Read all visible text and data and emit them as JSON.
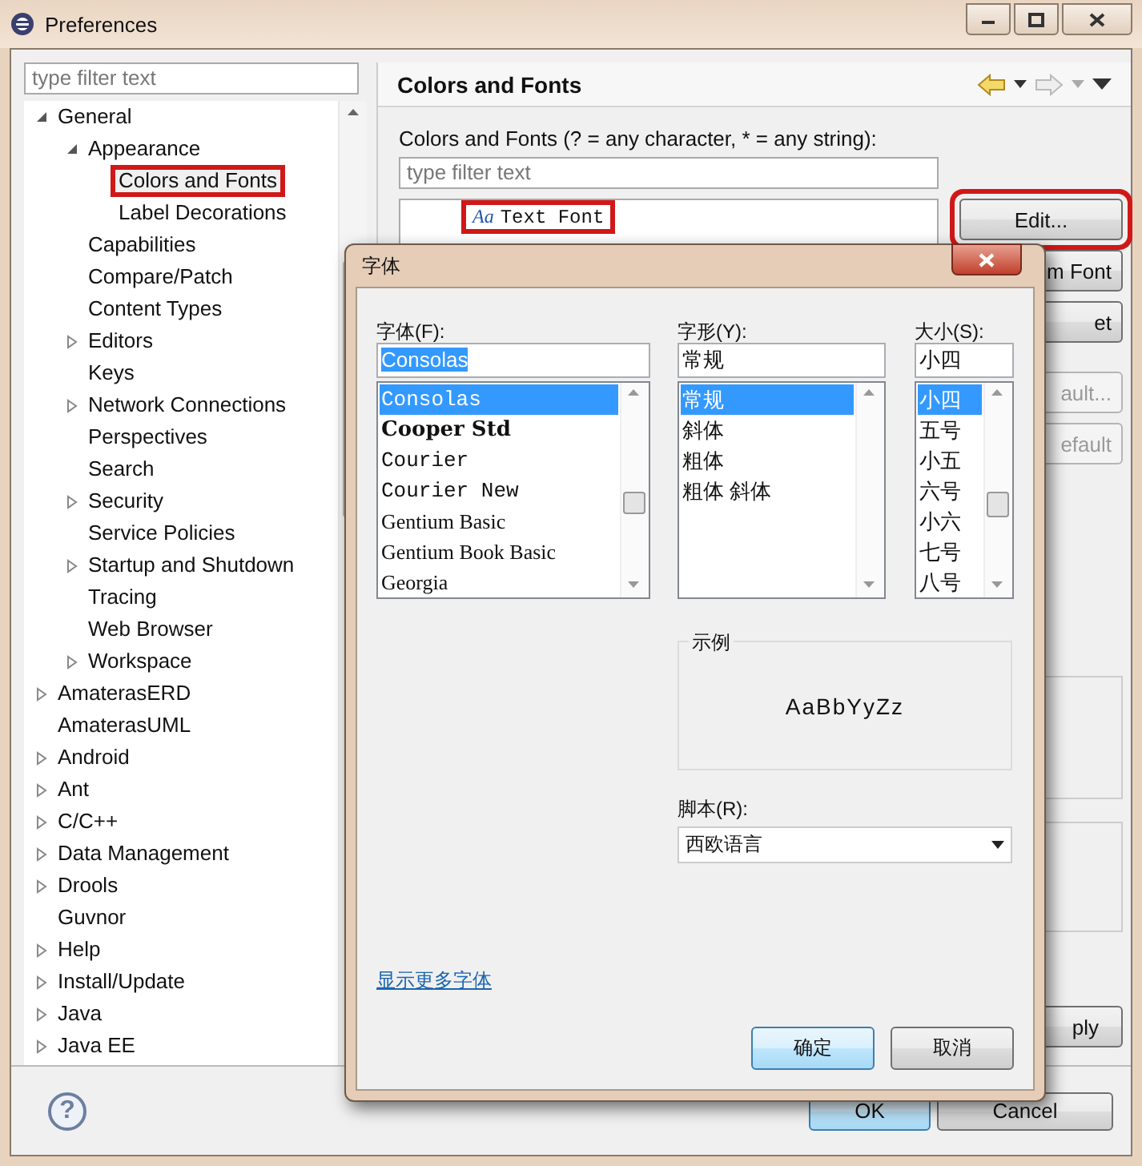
{
  "window": {
    "title": "Preferences"
  },
  "sidebar": {
    "filter_placeholder": "type filter text",
    "tree": [
      {
        "label": "General",
        "expandable": true,
        "expanded": true,
        "selected": false,
        "highlighted": false,
        "children": [
          {
            "label": "Appearance",
            "expandable": true,
            "expanded": true,
            "selected": false,
            "highlighted": false,
            "children": [
              {
                "label": "Colors and Fonts",
                "expandable": false,
                "selected": true,
                "highlighted": true
              },
              {
                "label": "Label Decorations",
                "expandable": false,
                "selected": false,
                "highlighted": false
              }
            ]
          },
          {
            "label": "Capabilities",
            "expandable": false,
            "selected": false,
            "highlighted": false
          },
          {
            "label": "Compare/Patch",
            "expandable": false,
            "selected": false,
            "highlighted": false
          },
          {
            "label": "Content Types",
            "expandable": false,
            "selected": false,
            "highlighted": false
          },
          {
            "label": "Editors",
            "expandable": true,
            "expanded": false,
            "selected": false,
            "highlighted": false
          },
          {
            "label": "Keys",
            "expandable": false,
            "selected": false,
            "highlighted": false
          },
          {
            "label": "Network Connections",
            "expandable": true,
            "expanded": false,
            "selected": false,
            "highlighted": false
          },
          {
            "label": "Perspectives",
            "expandable": false,
            "selected": false,
            "highlighted": false
          },
          {
            "label": "Search",
            "expandable": false,
            "selected": false,
            "highlighted": false
          },
          {
            "label": "Security",
            "expandable": true,
            "expanded": false,
            "selected": false,
            "highlighted": false
          },
          {
            "label": "Service Policies",
            "expandable": false,
            "selected": false,
            "highlighted": false
          },
          {
            "label": "Startup and Shutdown",
            "expandable": true,
            "expanded": false,
            "selected": false,
            "highlighted": false
          },
          {
            "label": "Tracing",
            "expandable": false,
            "selected": false,
            "highlighted": false
          },
          {
            "label": "Web Browser",
            "expandable": false,
            "selected": false,
            "highlighted": false
          },
          {
            "label": "Workspace",
            "expandable": true,
            "expanded": false,
            "selected": false,
            "highlighted": false
          }
        ]
      },
      {
        "label": "AmaterasERD",
        "expandable": true,
        "expanded": false,
        "selected": false,
        "highlighted": false
      },
      {
        "label": "AmaterasUML",
        "expandable": false,
        "selected": false,
        "highlighted": false
      },
      {
        "label": "Android",
        "expandable": true,
        "expanded": false,
        "selected": false,
        "highlighted": false
      },
      {
        "label": "Ant",
        "expandable": true,
        "expanded": false,
        "selected": false,
        "highlighted": false
      },
      {
        "label": "C/C++",
        "expandable": true,
        "expanded": false,
        "selected": false,
        "highlighted": false
      },
      {
        "label": "Data Management",
        "expandable": true,
        "expanded": false,
        "selected": false,
        "highlighted": false
      },
      {
        "label": "Drools",
        "expandable": true,
        "expanded": false,
        "selected": false,
        "highlighted": false
      },
      {
        "label": "Guvnor",
        "expandable": false,
        "selected": false,
        "highlighted": false
      },
      {
        "label": "Help",
        "expandable": true,
        "expanded": false,
        "selected": false,
        "highlighted": false
      },
      {
        "label": "Install/Update",
        "expandable": true,
        "expanded": false,
        "selected": false,
        "highlighted": false
      },
      {
        "label": "Java",
        "expandable": true,
        "expanded": false,
        "selected": false,
        "highlighted": false
      },
      {
        "label": "Java EE",
        "expandable": true,
        "expanded": false,
        "selected": false,
        "highlighted": false
      }
    ]
  },
  "page": {
    "title": "Colors and Fonts",
    "filter_label": "Colors and Fonts (? = any character, * = any string):",
    "filter_placeholder": "type filter text",
    "tree": [
      {
        "icon": "Aa",
        "label": "Text Font",
        "highlighted": true
      }
    ],
    "side_buttons": [
      {
        "label": "Edit...",
        "disabled": false,
        "highlighted": true
      },
      {
        "label": "m Font",
        "disabled": false,
        "highlighted": false
      },
      {
        "label": "et",
        "disabled": false,
        "highlighted": false
      },
      {
        "label": "ault...",
        "disabled": true,
        "highlighted": false
      },
      {
        "label": "efault",
        "disabled": true,
        "highlighted": false
      }
    ],
    "apply_button": "ply"
  },
  "help_button": "?",
  "footer_buttons": [
    {
      "label": "OK",
      "default": true
    },
    {
      "label": "Cancel",
      "default": false
    }
  ],
  "font_dialog": {
    "title": "字体",
    "columns": [
      {
        "label": "字体(F):",
        "value": "Consolas",
        "value_selected": true,
        "items": [
          {
            "label": "Consolas",
            "kind": "mono",
            "selected": true
          },
          {
            "label": "Cooper Std",
            "kind": "heavy",
            "selected": false
          },
          {
            "label": "Courier",
            "kind": "mono",
            "selected": false
          },
          {
            "label": "Courier New",
            "kind": "mono",
            "selected": false
          },
          {
            "label": "Gentium Basic",
            "kind": "serif",
            "selected": false
          },
          {
            "label": "Gentium Book Basic",
            "kind": "serif",
            "selected": false
          },
          {
            "label": "Georgia",
            "kind": "serif",
            "selected": false
          }
        ]
      },
      {
        "label": "字形(Y):",
        "value": "常规",
        "value_selected": false,
        "items": [
          {
            "label": "常规",
            "kind": "plain",
            "selected": true
          },
          {
            "label": "斜体",
            "kind": "plain",
            "selected": false
          },
          {
            "label": "粗体",
            "kind": "plain",
            "selected": false
          },
          {
            "label": "粗体 斜体",
            "kind": "plain",
            "selected": false
          }
        ]
      },
      {
        "label": "大小(S):",
        "value": "小四",
        "value_selected": false,
        "items": [
          {
            "label": "小四",
            "kind": "plain",
            "selected": true
          },
          {
            "label": "五号",
            "kind": "plain",
            "selected": false
          },
          {
            "label": "小五",
            "kind": "plain",
            "selected": false
          },
          {
            "label": "六号",
            "kind": "plain",
            "selected": false
          },
          {
            "label": "小六",
            "kind": "plain",
            "selected": false
          },
          {
            "label": "七号",
            "kind": "plain",
            "selected": false
          },
          {
            "label": "八号",
            "kind": "plain",
            "selected": false
          }
        ]
      }
    ],
    "sample": {
      "label": "示例",
      "text": "AaBbYyZz"
    },
    "script": {
      "label": "脚本(R):",
      "value": "西欧语言"
    },
    "more_fonts_link": "显示更多字体",
    "buttons": [
      {
        "label": "确定",
        "default": true
      },
      {
        "label": "取消",
        "default": false
      }
    ]
  }
}
